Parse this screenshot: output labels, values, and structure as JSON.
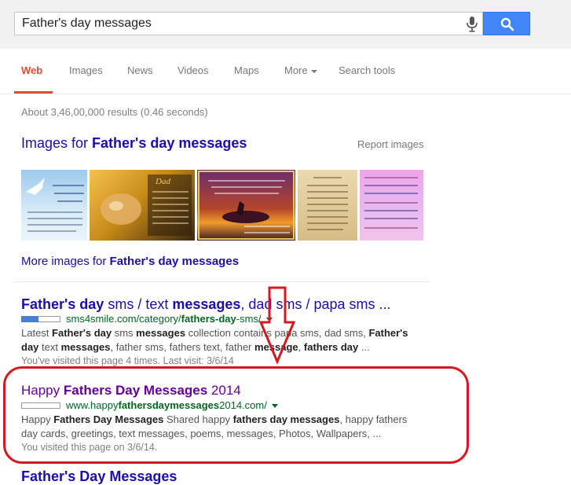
{
  "search": {
    "query": "Father's day messages",
    "mic_icon": "microphone-icon",
    "search_icon": "magnifier-icon",
    "button_color": "#4285f4"
  },
  "nav": {
    "tabs": [
      {
        "label": "Web",
        "active": true
      },
      {
        "label": "Images"
      },
      {
        "label": "News"
      },
      {
        "label": "Videos"
      },
      {
        "label": "Maps"
      },
      {
        "label": "More"
      },
      {
        "label": "Search tools"
      }
    ],
    "accent_color": "#dd4b39"
  },
  "stats": "About 3,46,00,000 results (0.46 seconds)",
  "images_block": {
    "heading_prefix": "Images for ",
    "heading_bold": "Father's day messages",
    "report": "Report images",
    "more_prefix": "More images for ",
    "more_bold": "Father's day messages",
    "thumb_texts": [
      "To My Wonderful Father on Father's Day...",
      "Dad",
      "Some Fathers work with cattle, while others build machines, Some do their work in fancy suits and others work in jeans.",
      "Thank You Dad",
      ""
    ]
  },
  "results": [
    {
      "title_parts": [
        {
          "t": "Father's day",
          "b": true
        },
        {
          "t": " sms / text ",
          "b": false
        },
        {
          "t": "messages",
          "b": true
        },
        {
          "t": ", dad sms / papa sms ...",
          "b": false
        }
      ],
      "url_parts": [
        {
          "t": "sms4smile.com/category/",
          "b": false
        },
        {
          "t": "fathers-day",
          "b": true
        },
        {
          "t": "-sms/",
          "b": false
        }
      ],
      "snippet_line1": [
        {
          "t": "Latest ",
          "b": false
        },
        {
          "t": "Father's day",
          "b": true
        },
        {
          "t": " sms ",
          "b": false
        },
        {
          "t": "messages",
          "b": true
        },
        {
          "t": " collection contains papa sms, dad sms, ",
          "b": false
        },
        {
          "t": "Father's",
          "b": true
        }
      ],
      "snippet_line2": [
        {
          "t": "day",
          "b": true
        },
        {
          "t": " text ",
          "b": false
        },
        {
          "t": "messages",
          "b": true
        },
        {
          "t": ", father sms, fathers text, father ",
          "b": false
        },
        {
          "t": "message",
          "b": true
        },
        {
          "t": ", ",
          "b": false
        },
        {
          "t": "fathers day",
          "b": true
        },
        {
          "t": " ...",
          "b": false
        }
      ],
      "visited": "You've visited this page 4 times. Last visit: 3/6/14"
    },
    {
      "title_parts": [
        {
          "t": "Happy ",
          "b": false
        },
        {
          "t": "Fathers Day Messages",
          "b": true
        },
        {
          "t": " 2014",
          "b": false
        }
      ],
      "url_parts": [
        {
          "t": "www.happy",
          "b": false
        },
        {
          "t": "fathersdaymessages",
          "b": true
        },
        {
          "t": "2014.com/",
          "b": false
        }
      ],
      "snippet_line1": [
        {
          "t": "Happy ",
          "b": false
        },
        {
          "t": "Fathers Day Messages",
          "b": true
        },
        {
          "t": " Shared happy ",
          "b": false
        },
        {
          "t": "fathers day messages",
          "b": true
        },
        {
          "t": ", happy fathers",
          "b": false
        }
      ],
      "snippet_line2": [
        {
          "t": "day cards, greetings, text messages, poems, messages, Photos, Wallpapers, ...",
          "b": false
        }
      ],
      "visited": "You visited this page on 3/6/14."
    },
    {
      "title_parts": [
        {
          "t": "Father's Day Messages",
          "b": true
        }
      ]
    }
  ],
  "annotation": {
    "highlight_color": "#d51920",
    "arrow_icon": "down-arrow-icon"
  }
}
